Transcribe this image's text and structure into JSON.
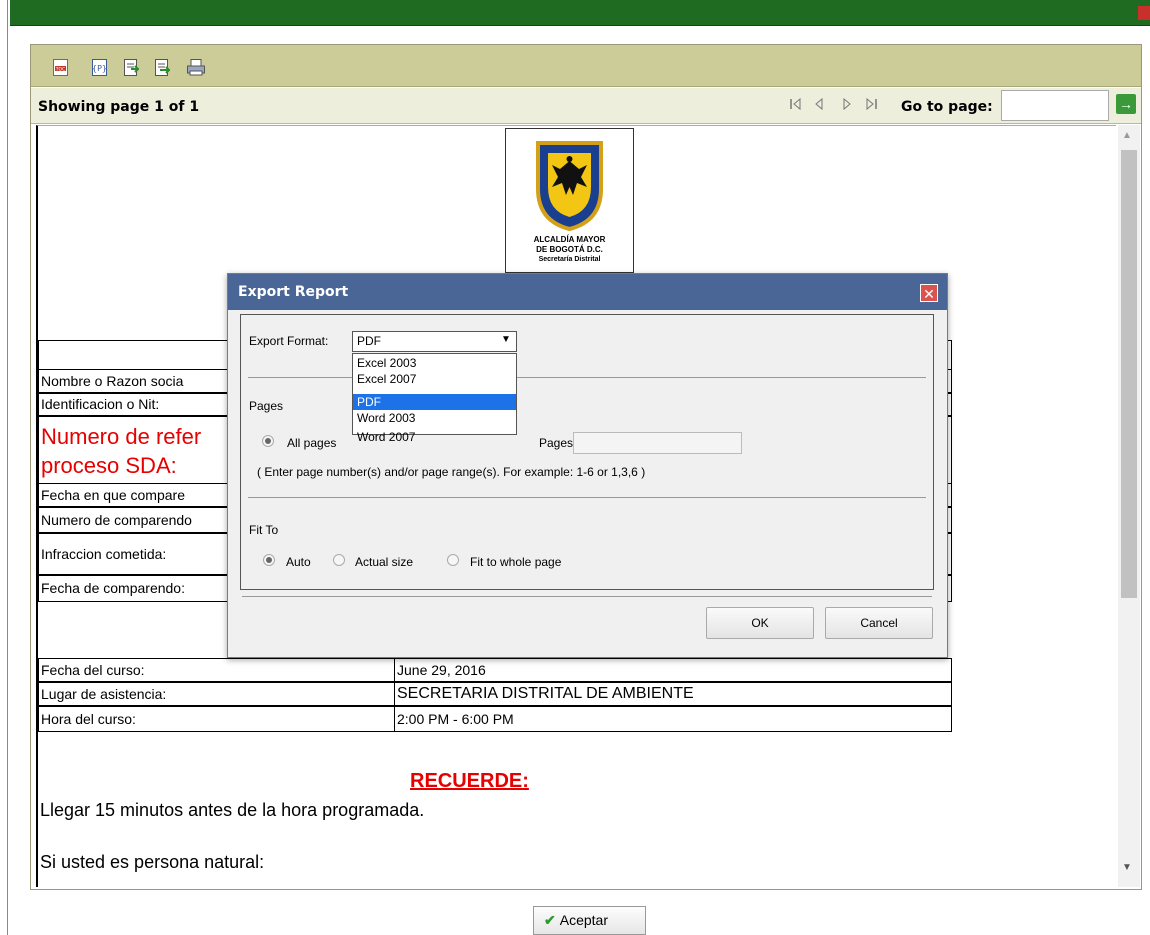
{
  "colors": {
    "topbar": "#1f6b22",
    "toolbar": "#cccc99",
    "navbar": "#eeeedd",
    "dialog_title": "#4a6696",
    "highlight": "#1e72e8",
    "alert_red": "#e60000"
  },
  "toolbar": {
    "icons": [
      "toc-icon",
      "parameters-icon",
      "export-data-icon",
      "export-report-icon",
      "print-icon"
    ]
  },
  "nav": {
    "showing_text": "Showing page  1  of  1",
    "first_icon": "first-page-icon",
    "prev_icon": "prev-page-icon",
    "next_icon": "next-page-icon",
    "last_icon": "last-page-icon",
    "goto_label": "Go to page:",
    "goto_value": "",
    "goto_btn_icon": "arrow-right-icon"
  },
  "logo": {
    "line1": "ALCALDÍA MAYOR",
    "line2": "DE BOGOTÁ D.C.",
    "line3": "Secretaría Distrital"
  },
  "report": {
    "rows_top": [
      {
        "label": "Nombre o Razon socia"
      },
      {
        "label": "Identificacion o Nit:"
      },
      {
        "label": "Numero de refer"
      },
      {
        "label": "proceso SDA:"
      },
      {
        "label": "Fecha en que compare"
      },
      {
        "label": "Numero de comparendo"
      },
      {
        "label": "Infraccion cometida:"
      },
      {
        "label": "Fecha de comparendo:"
      }
    ],
    "course": [
      {
        "label": "Fecha del curso:",
        "value": "June 29, 2016"
      },
      {
        "label": "Lugar de asistencia:",
        "value": "SECRETARIA DISTRITAL DE AMBIENTE"
      },
      {
        "label": "Hora del curso:",
        "value": "2:00 PM - 6:00 PM"
      }
    ],
    "recuerde": "RECUERDE:",
    "line1": "Llegar 15 minutos antes de la hora programada.",
    "line2": "Si usted es persona natural:"
  },
  "dialog": {
    "title": "Export Report",
    "format_label": "Export Format:",
    "format_value": "PDF",
    "options": [
      "Excel 2003",
      "Excel 2007",
      "PDF",
      "Word 2003",
      "Word 2007"
    ],
    "pages_heading": "Pages",
    "all_pages": "All pages",
    "pages_label": "Pages:",
    "pages_value": "",
    "pages_hint": "( Enter page number(s) and/or page range(s). For example: 1-6 or 1,3,6 )",
    "fit_heading": "Fit To",
    "fit_auto": "Auto",
    "fit_actual": "Actual size",
    "fit_whole": "Fit to whole page",
    "ok": "OK",
    "cancel": "Cancel"
  },
  "footer": {
    "aceptar": "Aceptar"
  }
}
